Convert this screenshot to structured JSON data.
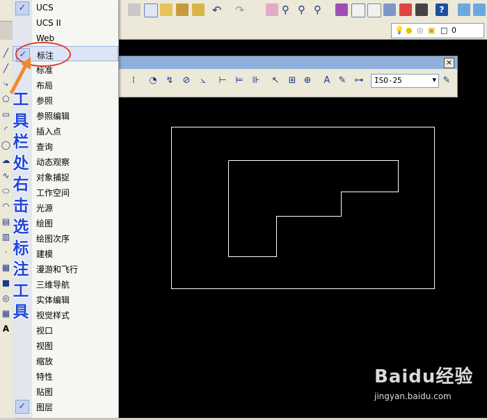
{
  "menu": {
    "items": [
      {
        "label": "UCS",
        "checked": true
      },
      {
        "label": "UCS II",
        "checked": false
      },
      {
        "label": "Web",
        "checked": false
      },
      {
        "label": "标注",
        "checked": true,
        "highlighted": true
      },
      {
        "label": "标准",
        "checked": false
      },
      {
        "label": "布局",
        "checked": false
      },
      {
        "label": "参照",
        "checked": false
      },
      {
        "label": "参照编辑",
        "checked": false
      },
      {
        "label": "插入点",
        "checked": false
      },
      {
        "label": "查询",
        "checked": false
      },
      {
        "label": "动态观察",
        "checked": false
      },
      {
        "label": "对象捕捉",
        "checked": false
      },
      {
        "label": "工作空间",
        "checked": false
      },
      {
        "label": "光源",
        "checked": false
      },
      {
        "label": "绘图",
        "checked": false
      },
      {
        "label": "绘图次序",
        "checked": false
      },
      {
        "label": "建模",
        "checked": false
      },
      {
        "label": "漫游和飞行",
        "checked": false
      },
      {
        "label": "三维导航",
        "checked": false
      },
      {
        "label": "实体编辑",
        "checked": false
      },
      {
        "label": "视觉样式",
        "checked": false
      },
      {
        "label": "视口",
        "checked": false
      },
      {
        "label": "视图",
        "checked": false
      },
      {
        "label": "缩放",
        "checked": false
      },
      {
        "label": "特性",
        "checked": false
      },
      {
        "label": "贴图",
        "checked": false
      },
      {
        "label": "图层",
        "checked": true
      }
    ],
    "check_glyph": "✓"
  },
  "caption": [
    "工",
    "具",
    "栏",
    "处",
    "右",
    "击",
    "选",
    "标",
    "注",
    "工",
    "具"
  ],
  "dim_toolbar": {
    "dim_style": "ISO-25",
    "close_glyph": "×"
  },
  "layer": {
    "value": "0"
  },
  "left_tool_text": "A",
  "watermark": {
    "brand": "Baidu经验",
    "url": "jingyan.baidu.com"
  },
  "colors": {
    "caption": "#2146d9",
    "ellipse": "#e23b2b",
    "arrow": "#f08a2c",
    "canvas": "#000000",
    "lines": "#ffffff"
  }
}
